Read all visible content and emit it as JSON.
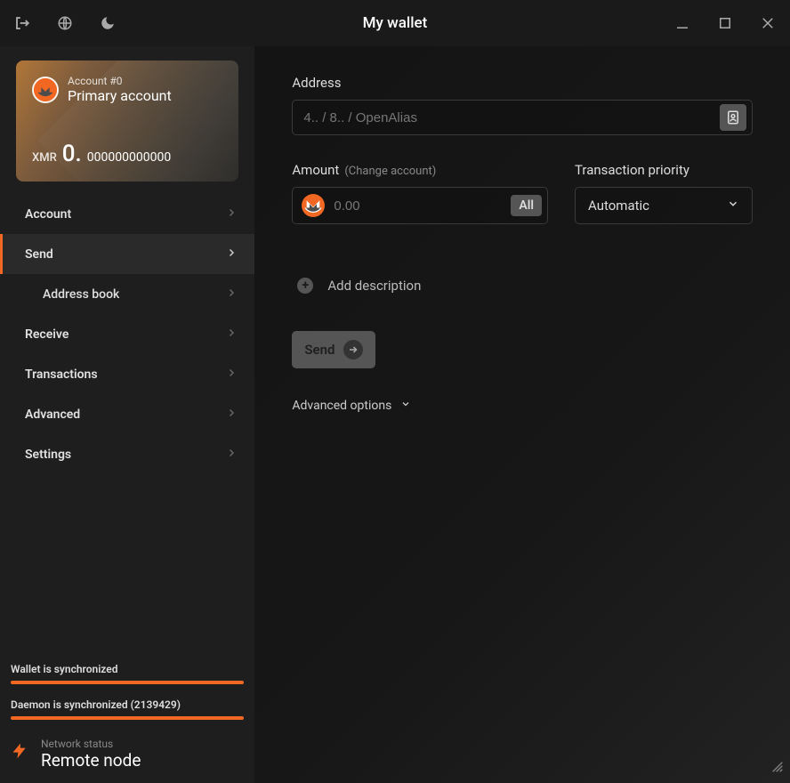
{
  "titlebar": {
    "title": "My wallet"
  },
  "account": {
    "num": "Account #0",
    "name": "Primary account",
    "currency": "XMR",
    "balance_int": "0.",
    "balance_dec": "000000000000"
  },
  "nav": {
    "account": "Account",
    "send": "Send",
    "address_book": "Address book",
    "receive": "Receive",
    "transactions": "Transactions",
    "advanced": "Advanced",
    "settings": "Settings"
  },
  "status": {
    "wallet_sync": "Wallet is synchronized",
    "daemon_sync": "Daemon is synchronized (2139429)",
    "net_label": "Network status",
    "net_value": "Remote node"
  },
  "send": {
    "address_label": "Address",
    "address_placeholder": "4.. / 8.. / OpenAlias",
    "amount_label": "Amount",
    "amount_sublabel": "(Change account)",
    "amount_placeholder": "0.00",
    "all_btn": "All",
    "priority_label": "Transaction priority",
    "priority_value": "Automatic",
    "add_desc": "Add description",
    "send_btn": "Send",
    "adv_opts": "Advanced options"
  }
}
